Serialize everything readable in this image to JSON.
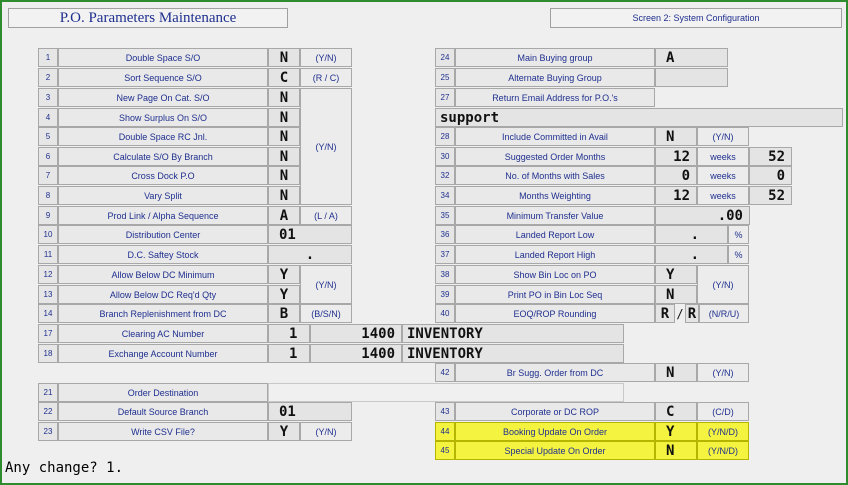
{
  "header": {
    "title": "P.O. Parameters Maintenance",
    "screen": "Screen 2:  System Configuration"
  },
  "left": [
    {
      "num": "1",
      "label": "Double Space S/O",
      "value": "N",
      "hint": "(Y/N)"
    },
    {
      "num": "2",
      "label": "Sort Sequence S/O",
      "value": "C",
      "hint": "(R / C)"
    },
    {
      "num": "3",
      "label": "New Page On Cat. S/O",
      "value": "N"
    },
    {
      "num": "4",
      "label": "Show Surplus On S/O",
      "value": "N"
    },
    {
      "num": "5",
      "label": "Double Space RC Jnl.",
      "value": "N"
    },
    {
      "num": "6",
      "label": "Calculate S/O By Branch",
      "value": "N"
    },
    {
      "num": "7",
      "label": "Cross Dock P.O",
      "value": "N"
    },
    {
      "num": "8",
      "label": "Vary Split",
      "value": "N"
    },
    {
      "num": "9",
      "label": "Prod Link / Alpha Sequence",
      "value": "A",
      "hint": "(L / A)"
    },
    {
      "num": "10",
      "label": "Distribution Center",
      "value": "01"
    },
    {
      "num": "11",
      "label": "D.C. Saftey Stock",
      "value": "."
    },
    {
      "num": "12",
      "label": "Allow Below DC Minimum",
      "value": "Y"
    },
    {
      "num": "13",
      "label": "Allow Below DC Req'd Qty",
      "value": "Y"
    },
    {
      "num": "14",
      "label": "Branch Replenishment from DC",
      "value": "B",
      "hint": "(B/S/N)"
    },
    {
      "num": "17",
      "label": "Clearing AC Number",
      "value": "1",
      "value2": "1400",
      "desc": "INVENTORY"
    },
    {
      "num": "18",
      "label": "Exchange Account Number",
      "value": "1",
      "value2": "1400",
      "desc": "INVENTORY"
    },
    {
      "num": "21",
      "label": "Order Destination"
    },
    {
      "num": "22",
      "label": "Default Source Branch",
      "value": "01"
    },
    {
      "num": "23",
      "label": "Write CSV File?",
      "value": "Y",
      "hint": "(Y/N)"
    }
  ],
  "left_group_hints": {
    "rows_3_8": "(Y/N)",
    "rows_12_13": "(Y/N)"
  },
  "right": [
    {
      "num": "24",
      "label": "Main Buying group",
      "value": "A"
    },
    {
      "num": "25",
      "label": "Alternate Buying Group",
      "value": ""
    },
    {
      "num": "27",
      "label": "Return Email Address for P.O.'s",
      "value": "support"
    },
    {
      "num": "28",
      "label": "Include Committed in Avail",
      "value": "N",
      "hint": "(Y/N)"
    },
    {
      "num": "30",
      "label": "Suggested Order Months",
      "value": "12",
      "unit": "weeks",
      "value2": "52"
    },
    {
      "num": "32",
      "label": "No. of Months with Sales",
      "value": "0",
      "unit": "weeks",
      "value2": "0"
    },
    {
      "num": "34",
      "label": "Months Weighting",
      "value": "12",
      "unit": "weeks",
      "value2": "52"
    },
    {
      "num": "35",
      "label": "Minimum Transfer Value",
      "value": ".00"
    },
    {
      "num": "36",
      "label": "Landed Report Low",
      "value": ".",
      "unit": "%"
    },
    {
      "num": "37",
      "label": "Landed Report High",
      "value": ".",
      "unit": "%"
    },
    {
      "num": "38",
      "label": "Show Bin Loc on PO",
      "value": "Y"
    },
    {
      "num": "39",
      "label": "Print PO in Bin Loc Seq",
      "value": "N"
    },
    {
      "num": "40",
      "label": "EOQ/ROP Rounding",
      "value": "R",
      "value2": "R",
      "sep": "/",
      "hint": "(N/R/U)"
    },
    {
      "num": "42",
      "label": "Br Sugg. Order from DC",
      "value": "N",
      "hint": "(Y/N)"
    },
    {
      "num": "43",
      "label": "Corporate or DC ROP",
      "value": "C",
      "hint": "(C/D)"
    },
    {
      "num": "44",
      "label": "Booking Update On Order",
      "value": "Y",
      "hint": "(Y/N/D)"
    },
    {
      "num": "45",
      "label": "Special Update On Order",
      "value": "N",
      "hint": "(Y/N/D)"
    }
  ],
  "right_group_hints": {
    "rows_38_39": "(Y/N)"
  },
  "prompt": "Any change? 1.",
  "colors": {
    "border": "#2e8b2e",
    "highlight": "#f4f440",
    "label_text": "#1f2f8f"
  }
}
